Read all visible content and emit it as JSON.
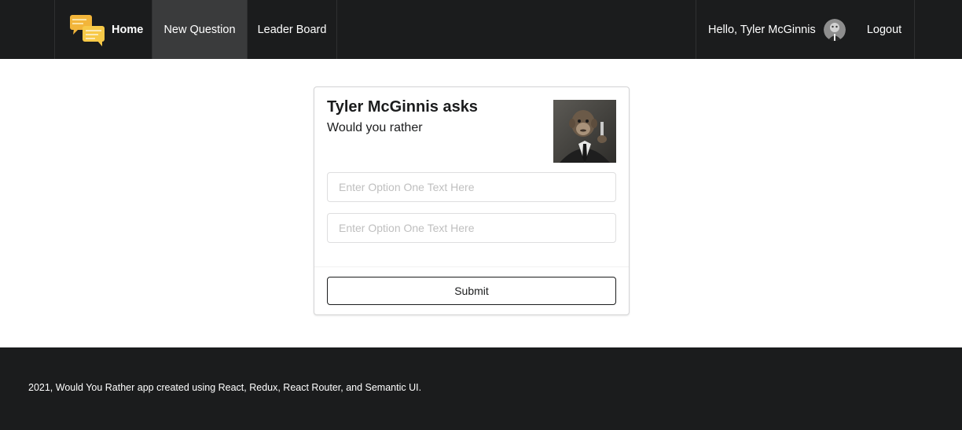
{
  "nav": {
    "home_label": "Home",
    "new_question_label": "New Question",
    "leader_board_label": "Leader Board",
    "greeting": "Hello, Tyler McGinnis",
    "logout_label": "Logout",
    "active_item": "New Question"
  },
  "card": {
    "author_title": "Tyler McGinnis asks",
    "subtitle": "Would you rather",
    "option_one": {
      "value": "",
      "placeholder": "Enter Option One Text Here"
    },
    "option_two": {
      "value": "",
      "placeholder": "Enter Option One Text Here"
    },
    "submit_label": "Submit"
  },
  "footer": {
    "text": "2021, Would You Rather app created using React, Redux, React Router, and Semantic UI."
  },
  "icons": {
    "logo": "speech-bubbles-icon",
    "nav_avatar": "user-avatar",
    "card_avatar": "author-avatar"
  },
  "colors": {
    "navbar_bg": "#1b1c1d",
    "active_item_bg": "#3a3b3c",
    "logo_yellow": "#f7c948",
    "footer_bg": "#1b1c1d"
  }
}
